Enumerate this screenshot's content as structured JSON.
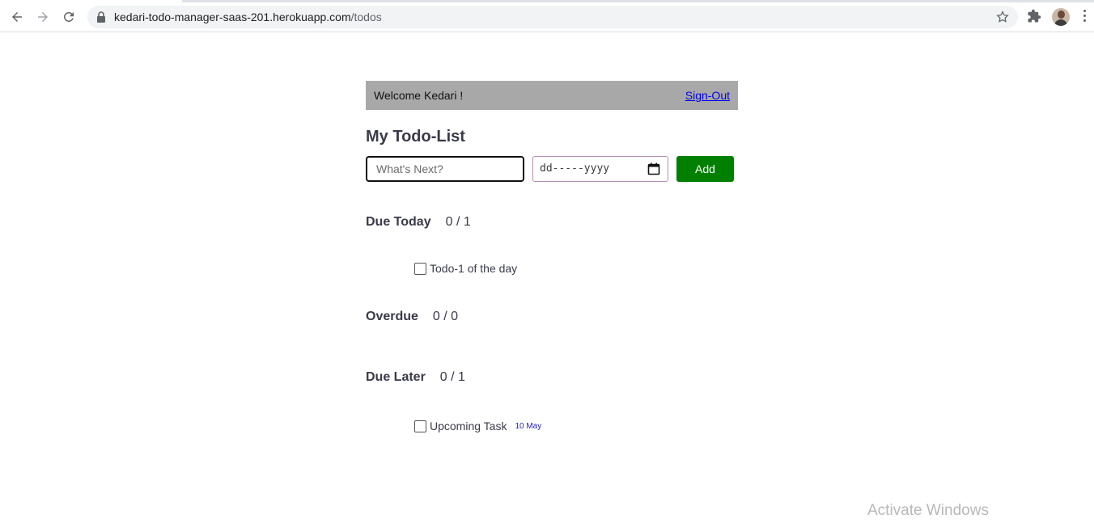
{
  "browser": {
    "url_host": "kedari-todo-manager-saas-201.herokuapp.com",
    "url_path": "/todos"
  },
  "header": {
    "welcome": "Welcome Kedari !",
    "signout": "Sign-Out"
  },
  "main": {
    "title": "My Todo-List",
    "todo_placeholder": "What's Next?",
    "date_placeholder": "dd-----yyyy",
    "add_label": "Add"
  },
  "sections": {
    "due_today": {
      "label": "Due Today",
      "count": "0 / 1",
      "items": [
        {
          "title": "Todo-1 of the day",
          "checked": false
        }
      ]
    },
    "overdue": {
      "label": "Overdue",
      "count": "0 / 0",
      "items": []
    },
    "due_later": {
      "label": "Due Later",
      "count": "0 / 1",
      "items": [
        {
          "title": "Upcoming Task",
          "due": "10 May",
          "checked": false
        }
      ]
    }
  },
  "watermark": "Activate Windows",
  "icons": {
    "back": "arrow-left-icon",
    "forward": "arrow-right-icon",
    "reload": "reload-icon",
    "lock": "lock-icon",
    "star": "star-icon",
    "extensions": "puzzle-icon",
    "menu": "kebab-menu-icon",
    "calendar": "calendar-icon"
  },
  "colors": {
    "welcome_bar": "#a8a8a8",
    "add_button": "#007f00",
    "due_date": "#2020c0"
  }
}
